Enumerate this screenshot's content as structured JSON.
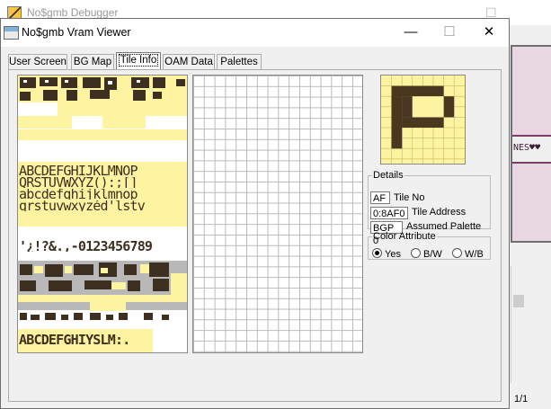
{
  "background_window": {
    "title": "No$gmb Debugger",
    "status_text": "NES♥♥",
    "page_indicator": "1/1"
  },
  "window": {
    "title": "No$gmb Vram Viewer",
    "minimize": "—",
    "maximize": "☐",
    "close": "✕"
  },
  "tabs": [
    {
      "label": "User Screen"
    },
    {
      "label": "BG Map"
    },
    {
      "label": "Tile Info"
    },
    {
      "label": "OAM Data"
    },
    {
      "label": "Palettes"
    }
  ],
  "active_tab": "Tile Info",
  "tile_sheet": {
    "rows": [
      "ABCDEFGHIJKLMNOP",
      "QRSTUVWXYZ():;[]",
      "abcdefghijklmnop",
      "qrstuvwxyzéd'lstv",
      "'¿!?&.,-0123456789",
      "ABCDEFGHIYSLM:."
    ]
  },
  "details": {
    "legend": "Details",
    "tile_no_value": "AF",
    "tile_no_label": "Tile No",
    "tile_address_value": "0:8AF0",
    "tile_address_label": "Tile Address",
    "palette_value": "BGP 0",
    "palette_label": "Assumed Palette"
  },
  "color_attribute": {
    "legend": "Color Attribute",
    "options": [
      "Yes",
      "B/W",
      "W/B"
    ],
    "selected": "Yes"
  },
  "colors": {
    "tile_bg": "#fdf3a0",
    "tile_dark": "#3d3020",
    "grid_line": "#b9b9b9"
  }
}
